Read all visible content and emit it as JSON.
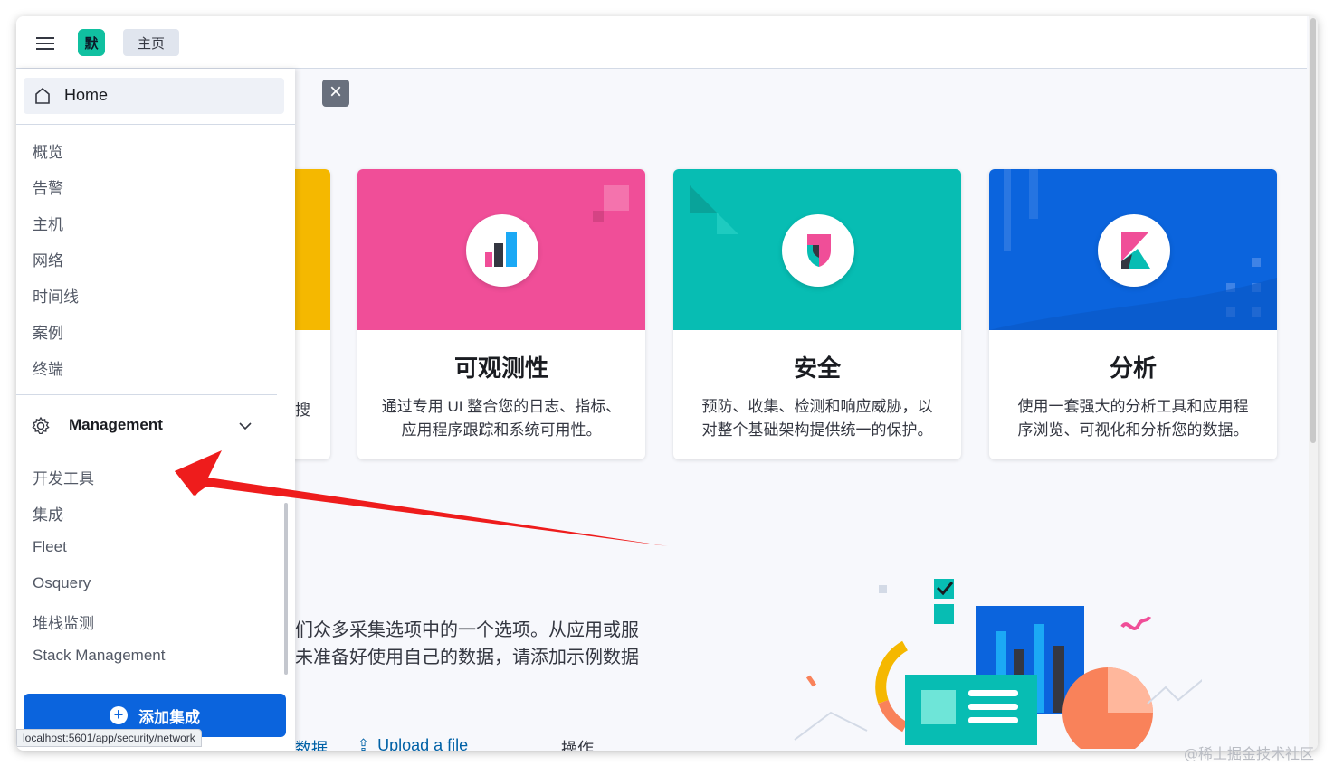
{
  "header": {
    "space_initial": "默",
    "breadcrumb": "主页"
  },
  "nav": {
    "home_label": "Home",
    "security_items": [
      "概览",
      "告警",
      "主机",
      "网络",
      "时间线",
      "案例",
      "终端"
    ],
    "management_label": "Management",
    "management_items": [
      "开发工具",
      "集成",
      "Fleet",
      "Osquery",
      "堆栈监测",
      "Stack Management"
    ],
    "add_integration_label": "添加集成"
  },
  "status_bar": "localhost:5601/app/security/network",
  "cards": {
    "partial_desc": "搜",
    "observability": {
      "title": "可观测性",
      "desc_lines": [
        "通过专用 UI 整合您的日志、指标、",
        "应用程序跟踪和系统可用性。"
      ]
    },
    "security": {
      "title": "安全",
      "desc_lines": [
        "预防、收集、检测和响应威胁，以",
        "对整个基础架构提供统一的保护。"
      ]
    },
    "analytics": {
      "title": "分析",
      "desc_lines": [
        "使用一套强大的分析工具和应用程",
        "序浏览、可视化和分析您的数据。"
      ]
    }
  },
  "ingest": {
    "line1": "们众多采集选项中的一个选项。从应用或服",
    "line2": "未准备好使用自己的数据，请添加示例数据"
  },
  "links": {
    "sample": "数据",
    "upload": "Upload a file",
    "more": "操作"
  },
  "watermark": "@稀土掘金技术社区",
  "colors": {
    "observability": "#f04e98",
    "security": "#07bdb3",
    "analytics": "#0b64dd",
    "partial_card": "#f5b800",
    "primary_button": "#0b64dd",
    "annotation_arrow": "#ee1c1c"
  },
  "icons": {
    "menu": "hamburger-icon",
    "close": "close-icon",
    "home": "home-icon",
    "management": "gear-icon",
    "chevron": "chevron-down-icon",
    "add": "plus-circle-icon",
    "upload": "upload-icon"
  }
}
